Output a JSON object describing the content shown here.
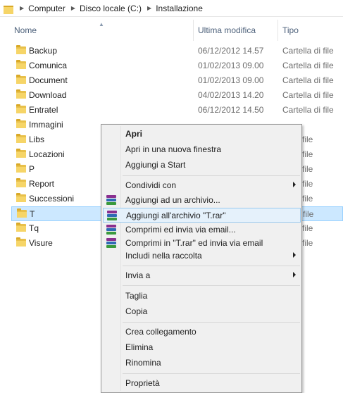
{
  "breadcrumb": {
    "items": [
      "Computer",
      "Disco locale (C:)",
      "Installazione"
    ]
  },
  "columns": {
    "name": "Nome",
    "modified": "Ultima modifica",
    "type": "Tipo"
  },
  "files": [
    {
      "name": "Backup",
      "date": "06/12/2012 14.57",
      "type": "Cartella di file"
    },
    {
      "name": "Comunica",
      "date": "01/02/2013 09.00",
      "type": "Cartella di file"
    },
    {
      "name": "Document",
      "date": "01/02/2013 09.00",
      "type": "Cartella di file"
    },
    {
      "name": "Download",
      "date": "04/02/2013 14.20",
      "type": "Cartella di file"
    },
    {
      "name": "Entratel",
      "date": "06/12/2012 14.50",
      "type": "Cartella di file"
    },
    {
      "name": "Immagini",
      "date": "",
      "type": ""
    },
    {
      "name": "Libs",
      "date": "",
      "type": "lla di file"
    },
    {
      "name": "Locazioni",
      "date": "",
      "type": "lla di file"
    },
    {
      "name": "P",
      "date": "",
      "type": "lla di file"
    },
    {
      "name": "Report",
      "date": "",
      "type": "lla di file"
    },
    {
      "name": "Successioni",
      "date": "",
      "type": "lla di file"
    },
    {
      "name": "T",
      "date": "",
      "type": "lla di file"
    },
    {
      "name": "Tq",
      "date": "",
      "type": "lla di file"
    },
    {
      "name": "Visure",
      "date": "",
      "type": "lla di file"
    }
  ],
  "context_menu": {
    "open": "Apri",
    "open_new_window": "Apri in una nuova finestra",
    "add_to_start": "Aggiungi a Start",
    "share_with": "Condividi con",
    "add_to_archive": "Aggiungi ad un archivio...",
    "add_to_t_rar": "Aggiungi all'archivio \"T.rar\"",
    "compress_email": "Comprimi ed invia via email...",
    "compress_t_rar_email": "Comprimi in \"T.rar\" ed invia via email",
    "include_in_library": "Includi nella raccolta",
    "send_to": "Invia a",
    "cut": "Taglia",
    "copy": "Copia",
    "create_shortcut": "Crea collegamento",
    "delete": "Elimina",
    "rename": "Rinomina",
    "properties": "Proprietà"
  },
  "colors": {
    "selection": "#cce8ff",
    "menu_highlight": "#e5f1fb",
    "folder": "#f6d568",
    "header_text": "#4c607a"
  }
}
